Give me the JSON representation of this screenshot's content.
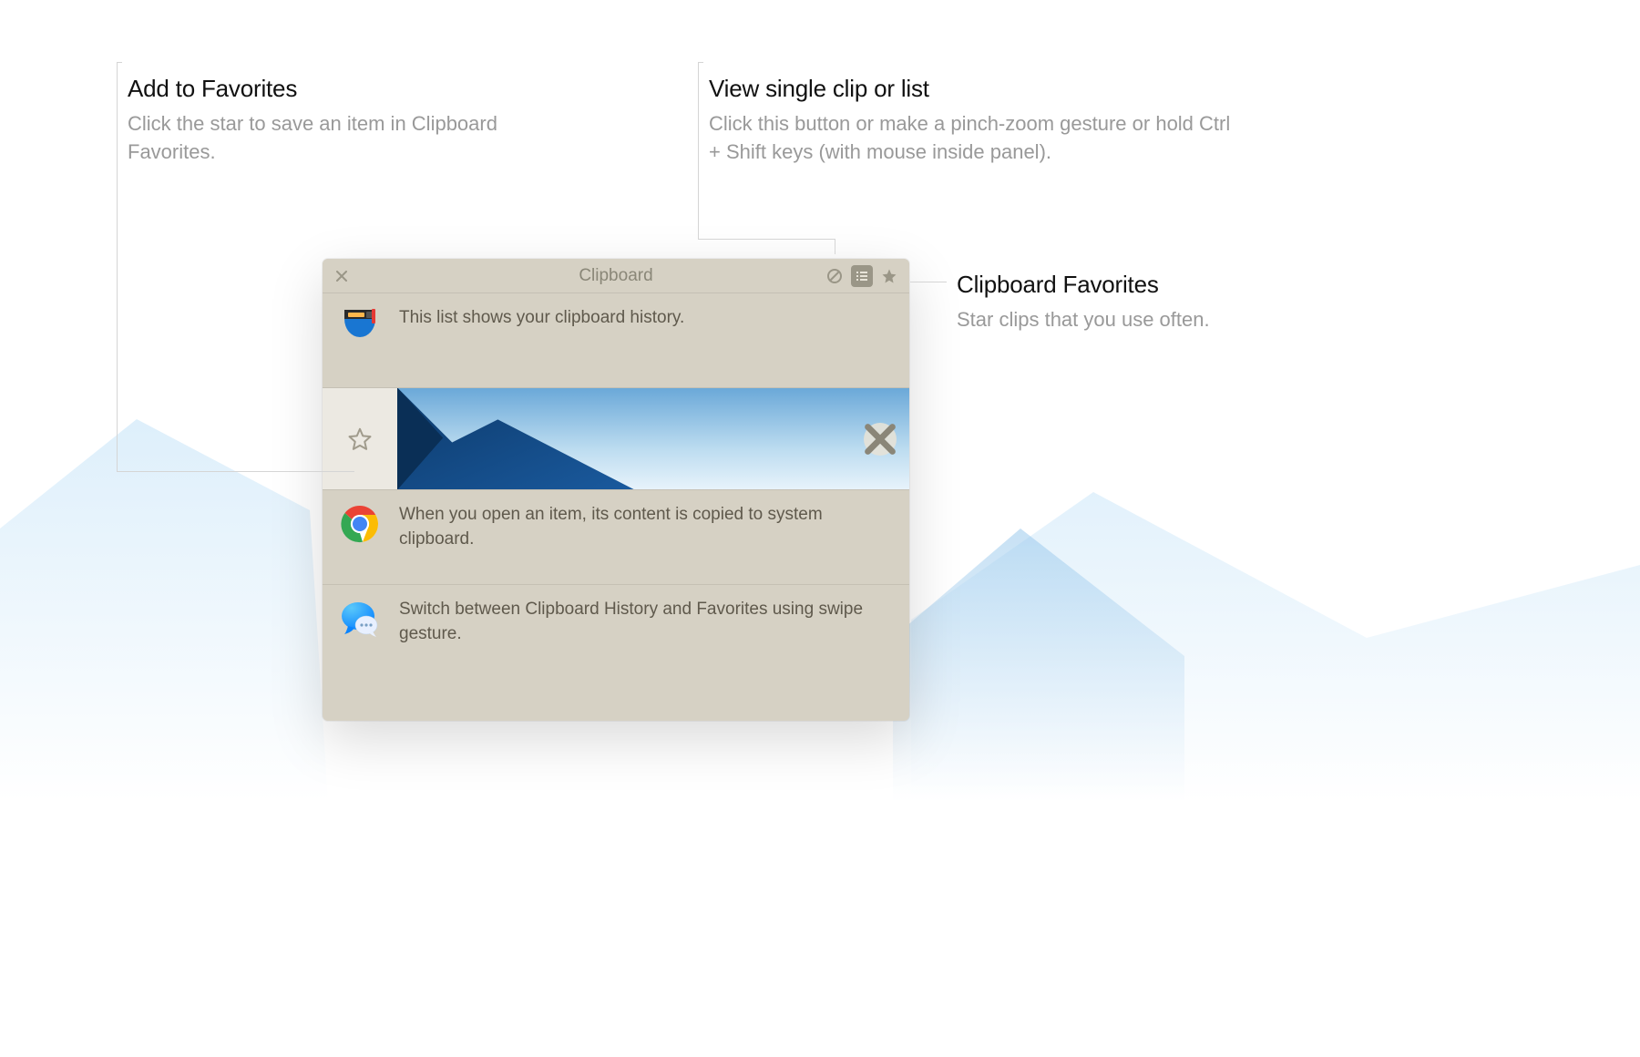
{
  "callouts": {
    "favorites": {
      "title": "Add to Favorites",
      "desc": "Click the star to save an item in Clipboard Favorites."
    },
    "viewMode": {
      "title": "View single clip or list",
      "desc": "Click this button or make a pinch-zoom gesture or hold Ctrl + Shift keys (with mouse inside panel)."
    },
    "favPanel": {
      "title": "Clipboard Favorites",
      "desc": "Star clips that you use often."
    }
  },
  "panel": {
    "title": "Clipboard",
    "items": [
      {
        "icon": "pocket",
        "text": "This list shows your clipboard history."
      },
      {
        "icon": "image",
        "text": "",
        "selected": true
      },
      {
        "icon": "chrome",
        "text": "When you open an item, its content is copied to system clipboard."
      },
      {
        "icon": "messages",
        "text": "Switch between Clipboard History and Favorites using swipe gesture."
      }
    ]
  }
}
